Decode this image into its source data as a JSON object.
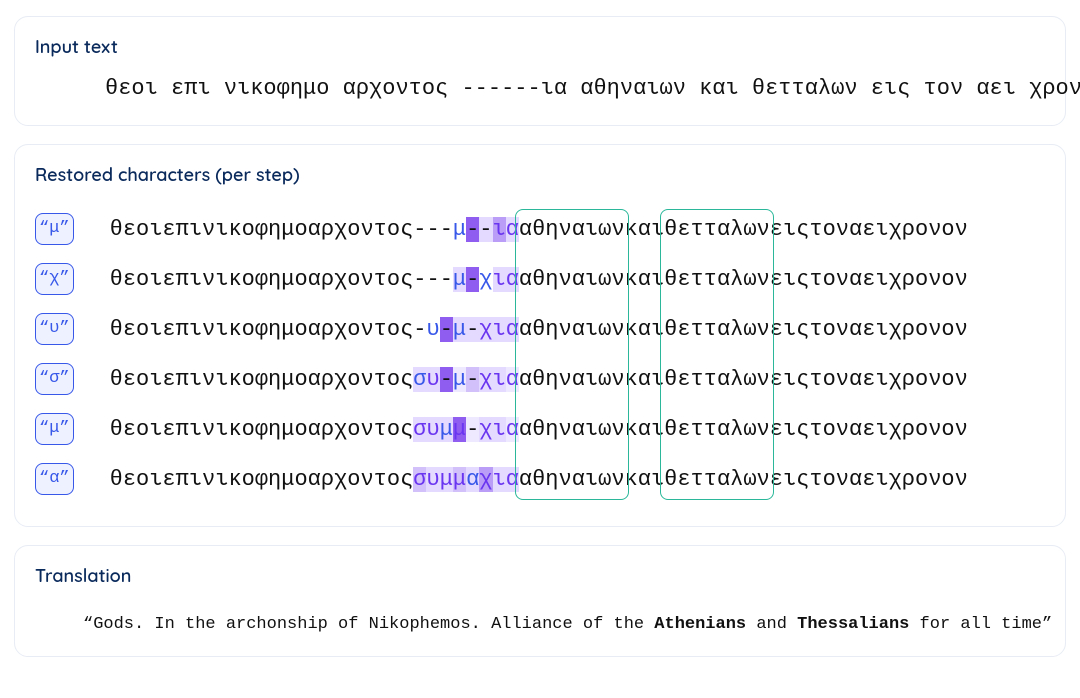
{
  "input": {
    "title": "Input text",
    "text": "θεοι επι νικοφημο αρχοντος ------ια αθηναιων και θετταλων εις τον αει χρονον"
  },
  "restored": {
    "title": "Restored characters (per step)",
    "pre": "θεοι επι νικοφημο αρχοντος ",
    "post": " αθηναιων και θετταλων εις τον αει χρονον",
    "context_words": [
      "αθηναιων",
      "θετταλων"
    ],
    "steps": [
      {
        "chip": "“μ”",
        "slots": [
          {
            "t": "-",
            "c": "n",
            "h": 0
          },
          {
            "t": "-",
            "c": "n",
            "h": 0
          },
          {
            "t": "-",
            "c": "n",
            "h": 0
          },
          {
            "t": "μ",
            "c": "b",
            "h": 0
          },
          {
            "t": "-",
            "c": "n",
            "h": 5
          },
          {
            "t": "-",
            "c": "n",
            "h": 2
          },
          {
            "t": "ι",
            "c": "p",
            "h": 4
          },
          {
            "t": "α",
            "c": "p",
            "h": 2
          }
        ]
      },
      {
        "chip": "“χ”",
        "slots": [
          {
            "t": "-",
            "c": "n",
            "h": 0
          },
          {
            "t": "-",
            "c": "n",
            "h": 0
          },
          {
            "t": "-",
            "c": "n",
            "h": 0
          },
          {
            "t": "μ",
            "c": "b",
            "h": 2
          },
          {
            "t": "-",
            "c": "n",
            "h": 5
          },
          {
            "t": "χ",
            "c": "b",
            "h": 0
          },
          {
            "t": "ι",
            "c": "p",
            "h": 2
          },
          {
            "t": "α",
            "c": "p",
            "h": 2
          }
        ]
      },
      {
        "chip": "“υ”",
        "slots": [
          {
            "t": "-",
            "c": "n",
            "h": 0
          },
          {
            "t": "υ",
            "c": "b",
            "h": 0
          },
          {
            "t": "-",
            "c": "n",
            "h": 5
          },
          {
            "t": "μ",
            "c": "b",
            "h": 2
          },
          {
            "t": "-",
            "c": "n",
            "h": 2
          },
          {
            "t": "χ",
            "c": "p",
            "h": 2
          },
          {
            "t": "ι",
            "c": "p",
            "h": 2
          },
          {
            "t": "α",
            "c": "p",
            "h": 2
          }
        ]
      },
      {
        "chip": "“σ”",
        "slots": [
          {
            "t": "σ",
            "c": "b",
            "h": 2
          },
          {
            "t": "υ",
            "c": "p",
            "h": 2
          },
          {
            "t": "-",
            "c": "n",
            "h": 5
          },
          {
            "t": "μ",
            "c": "b",
            "h": 1
          },
          {
            "t": "-",
            "c": "n",
            "h": 3
          },
          {
            "t": "χ",
            "c": "p",
            "h": 2
          },
          {
            "t": "ι",
            "c": "p",
            "h": 2
          },
          {
            "t": "α",
            "c": "p",
            "h": 1
          }
        ]
      },
      {
        "chip": "“μ”",
        "slots": [
          {
            "t": "σ",
            "c": "p",
            "h": 2
          },
          {
            "t": "υ",
            "c": "p",
            "h": 2
          },
          {
            "t": "μ",
            "c": "b",
            "h": 2
          },
          {
            "t": "μ",
            "c": "p",
            "h": 5
          },
          {
            "t": "-",
            "c": "n",
            "h": 1
          },
          {
            "t": "χ",
            "c": "p",
            "h": 2
          },
          {
            "t": "ι",
            "c": "p",
            "h": 2
          },
          {
            "t": "α",
            "c": "p",
            "h": 1
          }
        ]
      },
      {
        "chip": "“α”",
        "slots": [
          {
            "t": "σ",
            "c": "p",
            "h": 3
          },
          {
            "t": "υ",
            "c": "p",
            "h": 2
          },
          {
            "t": "μ",
            "c": "p",
            "h": 2
          },
          {
            "t": "μ",
            "c": "p",
            "h": 3
          },
          {
            "t": "α",
            "c": "b",
            "h": 2
          },
          {
            "t": "χ",
            "c": "p",
            "h": 4
          },
          {
            "t": "ι",
            "c": "p",
            "h": 2
          },
          {
            "t": "α",
            "c": "p",
            "h": 2
          }
        ]
      }
    ]
  },
  "translation": {
    "title": "Translation",
    "open_q": "“",
    "close_q": "”",
    "parts": [
      {
        "t": "Gods. In the archonship of Nikophemos. Alliance of the ",
        "b": false
      },
      {
        "t": "Athenians",
        "b": true
      },
      {
        "t": " and ",
        "b": false
      },
      {
        "t": "Thessalians",
        "b": true
      },
      {
        "t": " for all time",
        "b": false
      }
    ]
  }
}
